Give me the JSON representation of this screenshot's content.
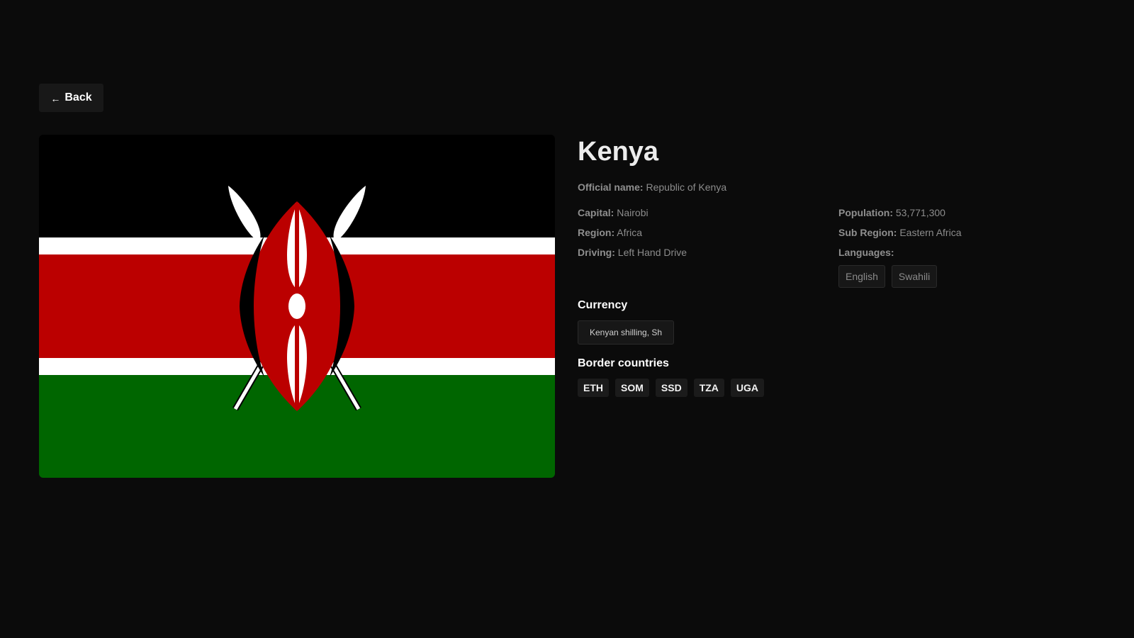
{
  "nav": {
    "back_label": "Back",
    "back_arrow": "←"
  },
  "country": {
    "name": "Kenya",
    "official_name_label": "Official name:",
    "official_name": "Republic of Kenya",
    "capital_label": "Capital:",
    "capital": "Nairobi",
    "region_label": "Region:",
    "region": "Africa",
    "driving_label": "Driving:",
    "driving": "Left Hand Drive",
    "population_label": "Population:",
    "population": "53,771,300",
    "subregion_label": "Sub Region:",
    "subregion": "Eastern Africa",
    "languages_label": "Languages:",
    "languages": [
      "English",
      "Swahili"
    ]
  },
  "currency": {
    "title": "Currency",
    "value": "Kenyan shilling, Sh"
  },
  "borders": {
    "title": "Border countries",
    "codes": [
      "ETH",
      "SOM",
      "SSD",
      "TZA",
      "UGA"
    ]
  },
  "flag": {
    "colors": {
      "black": "#000000",
      "red": "#bb0000",
      "green": "#006600",
      "white": "#ffffff"
    }
  }
}
